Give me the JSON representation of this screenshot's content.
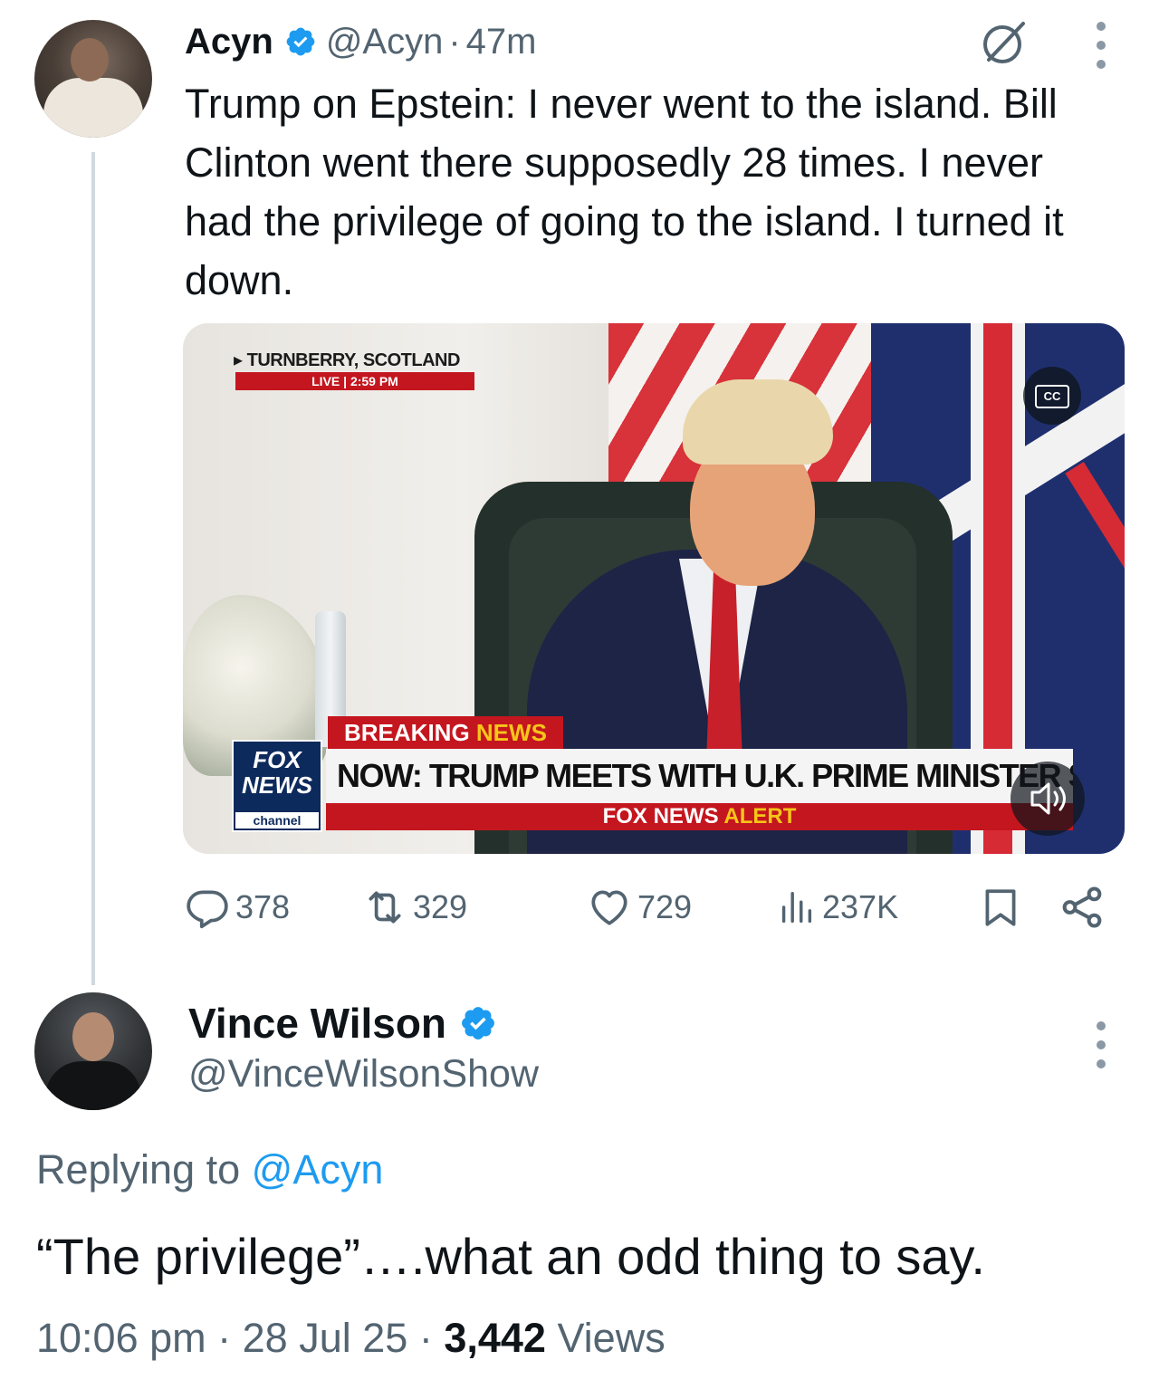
{
  "tweet1": {
    "author_name": "Acyn",
    "handle": "@Acyn",
    "separator": "·",
    "age": "47m",
    "text": "Trump on Epstein: I never went to the island. Bill Clinton went there supposedly 28 times. I never had the privilege of going to the island. I turned it down.",
    "media": {
      "location": "TURNBERRY, SCOTLAND",
      "live_label": "LIVE  |  2:59 PM",
      "cc_label": "CC",
      "breaking_word1": "BREAKING",
      "breaking_word2": "NEWS",
      "headline": "NOW: TRUMP MEETS WITH U.K. PRIME MINISTER STARMER",
      "alert_word1": "FOX NEWS",
      "alert_word2": "ALERT",
      "logo_line1": "FOX",
      "logo_line2": "NEWS",
      "logo_line3": "channel"
    },
    "stats": {
      "replies": "378",
      "reposts": "329",
      "likes": "729",
      "views": "237K"
    }
  },
  "tweet2": {
    "author_name": "Vince Wilson",
    "handle": "@VinceWilsonShow",
    "replying_prefix": "Replying to",
    "replying_mention": "@Acyn",
    "text": "“The privilege”….what an odd thing to say.",
    "time": "10:06 pm",
    "separator1": "·",
    "date": "28 Jul 25",
    "separator2": "·",
    "views_count": "3,442",
    "views_label": "Views"
  },
  "colors": {
    "verified_blue": "#1d9bf0",
    "secondary_text": "#536471",
    "primary_text": "#0f1419",
    "fox_red": "#c4161f",
    "fox_yellow": "#f5c518"
  },
  "icons": [
    "verified-icon",
    "grok-icon",
    "more-icon",
    "cc-icon",
    "mute-icon",
    "reply-icon",
    "repost-icon",
    "like-icon",
    "views-icon",
    "bookmark-icon",
    "share-icon"
  ]
}
